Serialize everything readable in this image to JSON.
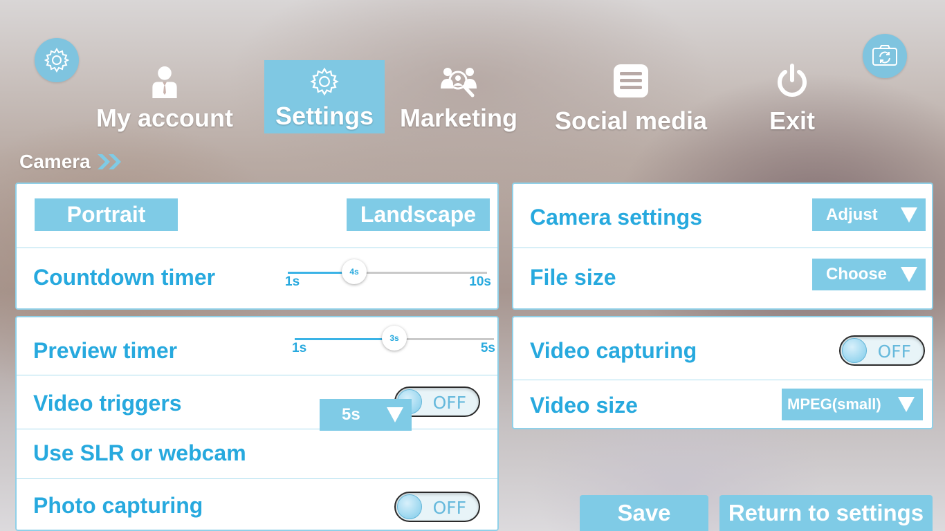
{
  "top_icons": {
    "left": "gear-icon",
    "right": "camera-switch-icon"
  },
  "nav": {
    "items": [
      {
        "label": "My account",
        "icon": "user-icon"
      },
      {
        "label": "Settings",
        "icon": "gear-icon",
        "active": true
      },
      {
        "label": "Marketing",
        "icon": "people-search-icon"
      },
      {
        "label": "Social media",
        "icon": "menu-list-icon"
      },
      {
        "label": "Exit",
        "icon": "power-icon"
      }
    ]
  },
  "section": {
    "title": "Camera"
  },
  "left_panel_top": {
    "portrait_label": "Portrait",
    "landscape_label": "Landscape",
    "countdown": {
      "label": "Countdown timer",
      "min": "1s",
      "max": "10s",
      "value": "4s",
      "value_num": 4,
      "min_num": 1,
      "max_num": 10
    }
  },
  "left_panel_bottom": {
    "preview": {
      "label": "Preview timer",
      "min": "1s",
      "max": "5s",
      "value": "3s",
      "value_num": 3,
      "min_num": 1,
      "max_num": 5
    },
    "video_triggers": {
      "label": "Video triggers",
      "toggle": "OFF",
      "dropdown": "5s"
    },
    "slr": {
      "label": "Use SLR or webcam"
    },
    "photo_capturing": {
      "label": "Photo capturing",
      "toggle": "OFF"
    }
  },
  "right_panel_top": {
    "camera_settings": {
      "label": "Camera settings",
      "dropdown": "Adjust"
    },
    "file_size": {
      "label": "File size",
      "dropdown": "Choose"
    }
  },
  "right_panel_bottom": {
    "video_capturing": {
      "label": "Video capturing",
      "toggle": "OFF"
    },
    "video_size": {
      "label": "Video size",
      "dropdown": "MPEG(small)"
    }
  },
  "footer": {
    "save_label": "Save",
    "return_label": "Return to settings"
  },
  "colors": {
    "accent": "#7fcbe6",
    "text_blue": "#27a9de"
  }
}
